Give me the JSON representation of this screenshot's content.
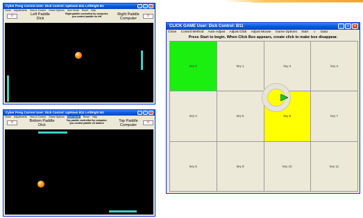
{
  "pong1": {
    "title": "Cyber Pong    Current User: Dick             Control: UpRown  B11  LeftRight  B1",
    "menu": [
      "Close",
      "Adjustments",
      "How to Control",
      "Game Options",
      "User Mode",
      "Reset",
      "Help"
    ],
    "score_left": "0",
    "score_right": "0",
    "left_label_1": "Left Paddle",
    "left_label_2": "Dick",
    "note_1": "Right paddle controlled by computer,",
    "note_2": "you control paddle on left",
    "right_label_1": "Right Paddle",
    "right_label_2": "Computer"
  },
  "pong2": {
    "title": "Cyber Pong    Current User: Dick             Control: UpRown  B11  LeftRight  B2",
    "menu": [
      "Close",
      "Adjustments",
      "How to Control",
      "Game Options",
      "User Mode",
      "Reset",
      "Help"
    ],
    "highlight_index": 4,
    "score_left": "0",
    "score_right": "0",
    "left_label_1": "Bottom Paddle",
    "left_label_2": "Dick",
    "note_1": "Top paddle controlled by computer,",
    "note_2": "you control paddle on bottom",
    "right_label_1": "Top Paddle",
    "right_label_2": "Computer"
  },
  "click": {
    "title": "CLICK GAME  User: Dick   Control: B11",
    "menu": [
      "Close",
      "Control Method",
      "Auto-Adjust",
      "Adjust Click",
      "Adjust Mouse",
      "Game Options",
      "Start",
      "☺",
      "Data"
    ],
    "message": "Press Start to begin.  When Click Box appears, create click to make box disappear.",
    "keys": [
      "key 0",
      "key 1",
      "key 2",
      "key 3",
      "key 4",
      "key 5",
      "key 6",
      "key 7",
      "key 8",
      "key 9",
      "key 10",
      "key 11"
    ],
    "colors": {
      "green": "#1aef10",
      "yellow": "#ffff00"
    }
  }
}
